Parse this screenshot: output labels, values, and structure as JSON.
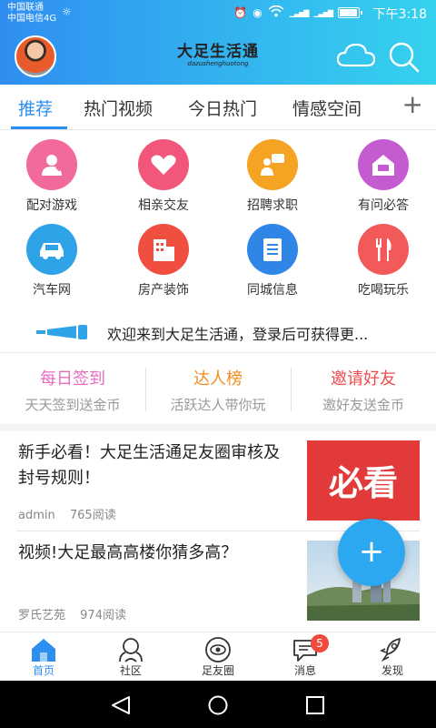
{
  "status_bar": {
    "carrier_1": "中国联通",
    "carrier_2": "中国电信4G",
    "time": "下午3:18"
  },
  "header": {
    "logo_cn": "大足生活通",
    "logo_pinyin": "dazushenghuotong"
  },
  "tabs": [
    {
      "label": "推荐",
      "active": true
    },
    {
      "label": "热门视频",
      "active": false
    },
    {
      "label": "今日热门",
      "active": false
    },
    {
      "label": "情感空间",
      "active": false
    }
  ],
  "tab_add_label": "+",
  "categories": [
    {
      "label": "配对游戏",
      "icon": "heart-user-icon",
      "color": "#f26a9c"
    },
    {
      "label": "相亲交友",
      "icon": "heart-cloud-icon",
      "color": "#f2567a"
    },
    {
      "label": "招聘求职",
      "icon": "presenter-icon",
      "color": "#f5a323"
    },
    {
      "label": "有问必答",
      "icon": "house-chat-icon",
      "color": "#c45bd0"
    },
    {
      "label": "汽车网",
      "icon": "car-icon",
      "color": "#2fa3e8"
    },
    {
      "label": "房产装饰",
      "icon": "building-icon",
      "color": "#f04e3e"
    },
    {
      "label": "同城信息",
      "icon": "document-icon",
      "color": "#2f86e6"
    },
    {
      "label": "吃喝玩乐",
      "icon": "fork-knife-icon",
      "color": "#f25a5a"
    }
  ],
  "notice": {
    "text": "欢迎来到大足生活通，登录后可获得更..."
  },
  "quick_actions": [
    {
      "title": "每日签到",
      "subtitle": "天天签到送金币",
      "color": "#e56bbf"
    },
    {
      "title": "达人榜",
      "subtitle": "活跃达人带你玩",
      "color": "#f28c1e"
    },
    {
      "title": "邀请好友",
      "subtitle": "邀好友送金币",
      "color": "#ef4b4b"
    }
  ],
  "articles": [
    {
      "title": "新手必看！大足生活通足友圈审核及封号规则！",
      "author": "admin",
      "reads": "765阅读",
      "thumb": "必看"
    },
    {
      "title": "视频!大足最高高楼你猜多高？",
      "author": "罗氏艺苑",
      "reads": "974阅读",
      "thumb": ""
    }
  ],
  "fab_label": "+",
  "bottom_nav": [
    {
      "label": "首页",
      "icon": "home-icon",
      "active": true
    },
    {
      "label": "社区",
      "icon": "community-icon",
      "active": false
    },
    {
      "label": "足友圈",
      "icon": "circle-eye-icon",
      "active": false
    },
    {
      "label": "消息",
      "icon": "message-icon",
      "active": false,
      "badge": "5"
    },
    {
      "label": "发现",
      "icon": "rocket-icon",
      "active": false
    }
  ],
  "colors": {
    "accent": "#2b8ef0",
    "header_gradient_start": "#2f8ef0",
    "header_gradient_end": "#35d2ee"
  }
}
